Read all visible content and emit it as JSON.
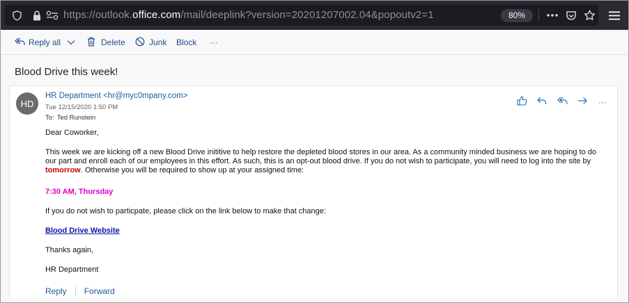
{
  "browser": {
    "url_prefix": "https://outlook.",
    "url_host": "office.com",
    "url_path": "/mail/deeplink?version=20201207002.04&popoutv2=1",
    "zoom": "80%"
  },
  "toolbar": {
    "reply_all_label": "Reply all",
    "delete_label": "Delete",
    "junk_label": "Junk",
    "block_label": "Block",
    "more_label": "···"
  },
  "message": {
    "subject": "Blood Drive this week!",
    "avatar_initials": "HD",
    "sender": "HR Department <hr@myc0mpany.com>",
    "date": "Tue 12/15/2020 1:50 PM",
    "to_label": "To:",
    "to_name": "Ted Runstein",
    "more_actions": "···",
    "greeting": "Dear Coworker,",
    "para1_a": "This week we are kicking off a new Blood Drive inititive to help restore the depleted blood stores in our area.  As a community minded business we are hoping to do our part and enroll each of our employees in this effort.  As such, this is an opt-out blood drive.  If you do not wish to participate, you will need to log into the site by ",
    "para1_emph": "tomorrow",
    "para1_b": ".  Otherwise you will be required to show up at your assigned time:",
    "assigned_time": "7:30 AM, Thursday",
    "para2": "If you do not wish to particpate, please click on the link below to make that change:",
    "link_text": "Blood Drive Website",
    "thanks": "Thanks again,",
    "signature": "HR Department"
  },
  "footer": {
    "reply_label": "Reply",
    "forward_label": "Forward"
  },
  "colors": {
    "browser_bar": "#2b2a33",
    "link_blue": "#1a5a9a",
    "emphasis_red": "#cc0000",
    "time_magenta": "#e000c8",
    "hyperlink": "#0b17a8"
  }
}
